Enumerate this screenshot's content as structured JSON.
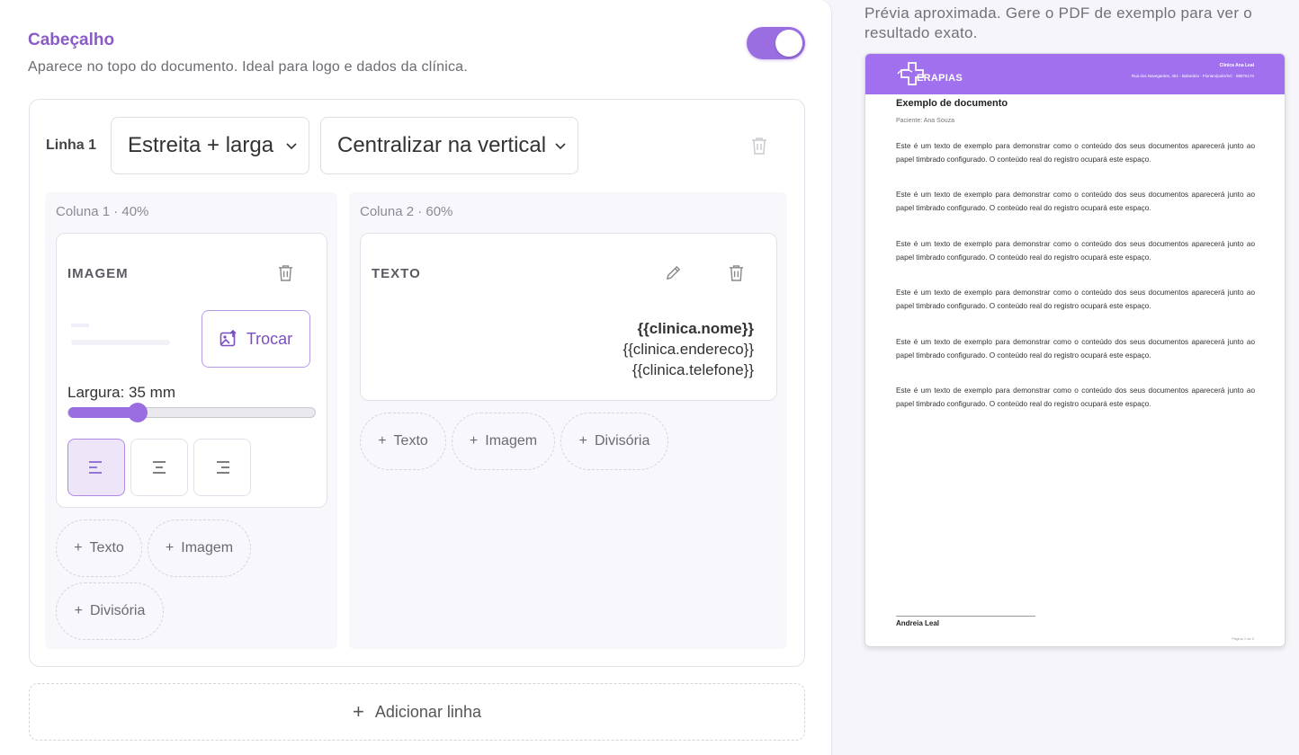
{
  "header_section": {
    "title": "Cabeçalho",
    "description": "Aparece no topo do documento. Ideal para logo e dados da clínica.",
    "enabled": true
  },
  "row": {
    "label": "Linha 1",
    "layout_select": "Estreita + larga",
    "align_select": "Centralizar na vertical"
  },
  "columns": [
    {
      "label": "Coluna 1 · 40%",
      "block": {
        "type": "IMAGEM",
        "replace_label": "Trocar",
        "width_label": "Largura: 35 mm",
        "width_mm": 35,
        "width_fraction": 0.28,
        "alignment_options": [
          "left",
          "center",
          "right"
        ],
        "alignment_selected": "left"
      },
      "add_buttons": [
        "Texto",
        "Imagem",
        "Divisória"
      ]
    },
    {
      "label": "Coluna 2 · 60%",
      "block": {
        "type": "TEXTO",
        "lines": [
          "{{clinica.nome}}",
          "{{clinica.endereco}}",
          "{{clinica.telefone}}"
        ]
      },
      "add_buttons": [
        "Texto",
        "Imagem",
        "Divisória"
      ]
    }
  ],
  "add_row_label": "Adicionar linha",
  "preview": {
    "note": "Prévia aproximada. Gere o PDF de exemplo para ver o resultado exato.",
    "brand_text": "ERAPIAS",
    "clinic_name": "Clínica Ana Leal",
    "clinic_address": "Rua dos Navegantes, 461 - Balneário · Florianópolis/SC · 98875170",
    "doc_title": "Exemplo de documento",
    "patient": "Paciente: Ana Souza",
    "paragraph": "Este é um texto de exemplo para demonstrar como o conteúdo dos seus documentos aparecerá junto ao papel timbrado configurado. O conteúdo real do registro ocupará este espaço.",
    "paragraph_count": 6,
    "signature": "Andreia Leal",
    "page_number": "Página 1 de 2"
  },
  "colors": {
    "accent": "#9a6ee0",
    "title": "#8a5cc8",
    "preview_header": "#a070ee"
  }
}
